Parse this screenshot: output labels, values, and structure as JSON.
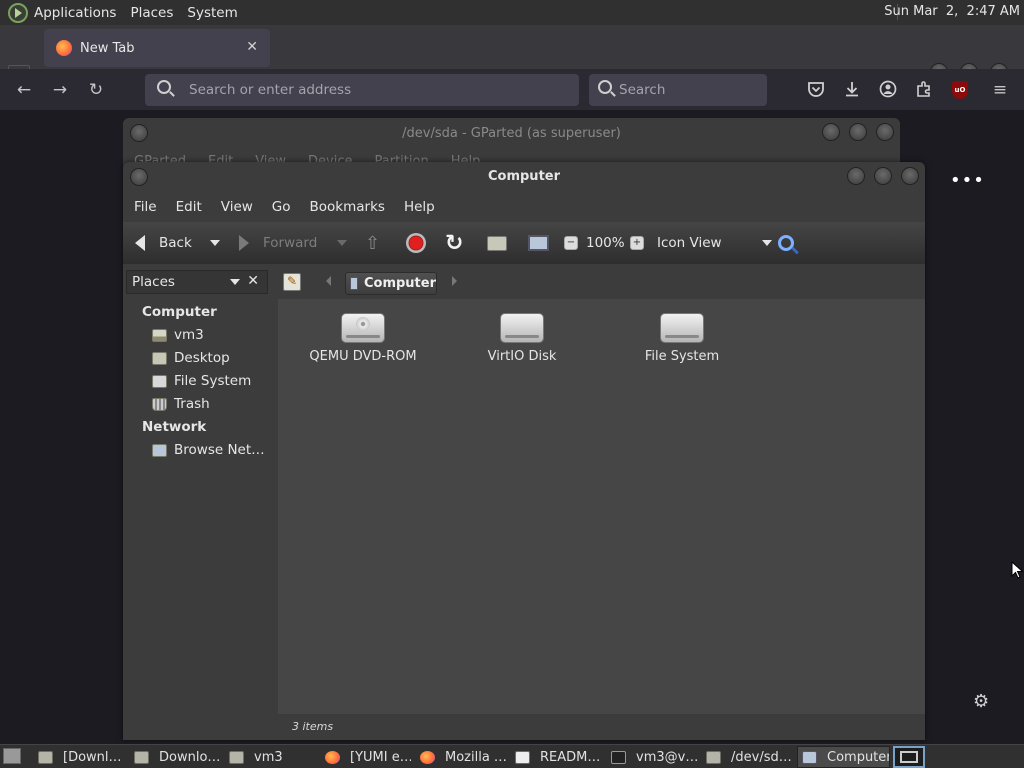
{
  "top_panel": {
    "menus": [
      "Applications",
      "Places",
      "System"
    ],
    "clock": "Sun Mar  2,  2:47 AM"
  },
  "firefox": {
    "tab_title": "New Tab",
    "url_placeholder": "Search or enter address",
    "search_placeholder": "Search"
  },
  "gparted": {
    "title": "/dev/sda - GParted (as superuser)",
    "menus": [
      "GParted",
      "Edit",
      "View",
      "Device",
      "Partition",
      "Help"
    ]
  },
  "caja": {
    "title": "Computer",
    "menus": [
      "File",
      "Edit",
      "View",
      "Go",
      "Bookmarks",
      "Help"
    ],
    "toolbar": {
      "back": "Back",
      "forward": "Forward",
      "zoom": "100%",
      "view_mode": "Icon View"
    },
    "sidebar": {
      "header": "Places",
      "sections": [
        {
          "title": "Computer",
          "items": [
            "vm3",
            "Desktop",
            "File System",
            "Trash"
          ]
        },
        {
          "title": "Network",
          "items": [
            "Browse Net…"
          ]
        }
      ]
    },
    "path": "Computer",
    "items": [
      "QEMU DVD-ROM",
      "VirtIO Disk",
      "File System"
    ],
    "status": "3 items"
  },
  "taskbar": {
    "tasks": [
      "[Downl…",
      "Downlo…",
      "vm3",
      "[YUMI e…",
      "Mozilla …",
      "READM…",
      "vm3@v…",
      "/dev/sd…",
      "Computer"
    ]
  }
}
